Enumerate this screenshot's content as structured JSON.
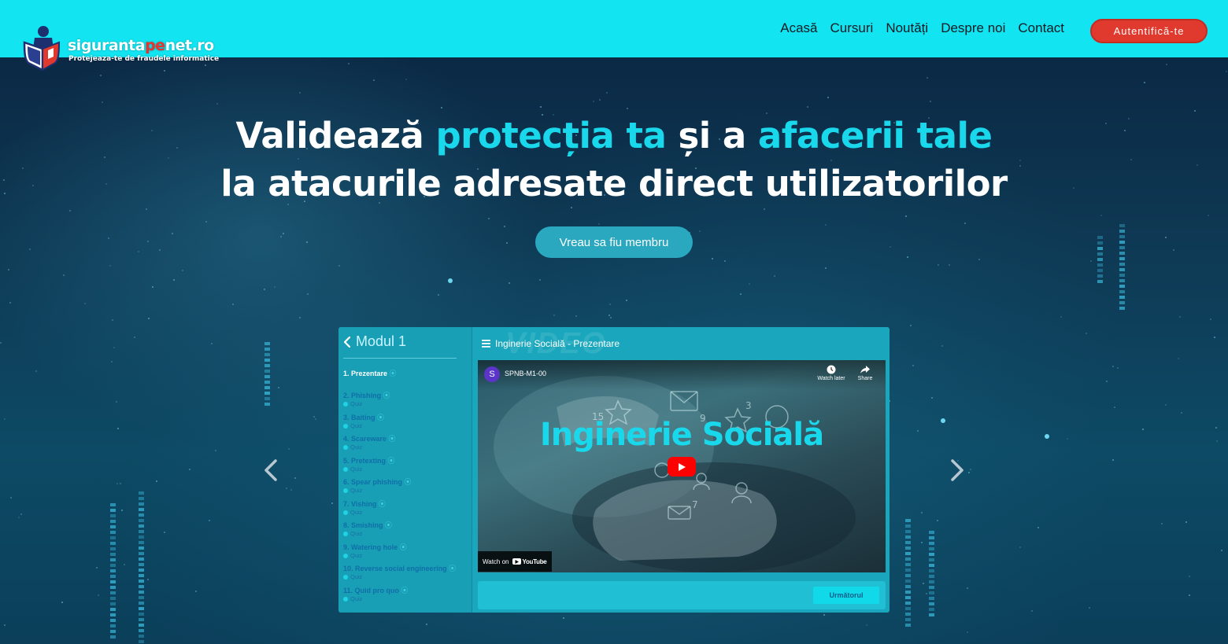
{
  "brand": {
    "name_part1": "siguranta",
    "name_accent": "pe",
    "name_part2": "net.ro",
    "tagline": "Protejeaza-te de fraudele informatice"
  },
  "nav": {
    "items": [
      "Acasă",
      "Cursuri",
      "Noutăți",
      "Despre noi",
      "Contact"
    ],
    "login_label": "Autentifică-te"
  },
  "hero": {
    "line1_a": "Validează ",
    "line1_b": "protecția ta",
    "line1_c": " și a ",
    "line1_d": "afacerii tale",
    "line2": "la atacurile adresate direct utilizatorilor",
    "cta_label": "Vreau sa fiu membru"
  },
  "slide": {
    "module_title": "Modul 1",
    "watermark": "VIDEO",
    "content_title": "Inginerie Socială - Prezentare",
    "lessons": [
      {
        "title": "1. Prezentare",
        "quiz": ""
      },
      {
        "title": "2. Phishing",
        "quiz": "Quiz"
      },
      {
        "title": "3. Baiting",
        "quiz": "Quiz"
      },
      {
        "title": "4. Scareware",
        "quiz": "Quiz"
      },
      {
        "title": "5. Pretexting",
        "quiz": "Quiz"
      },
      {
        "title": "6. Spear phishing",
        "quiz": "Quiz"
      },
      {
        "title": "7. Vishing",
        "quiz": "Quiz"
      },
      {
        "title": "8. Smishing",
        "quiz": "Quiz"
      },
      {
        "title": "9. Watering hole",
        "quiz": "Quiz"
      },
      {
        "title": "10. Reverse social engineering",
        "quiz": "Quiz"
      },
      {
        "title": "11. Quid pro quo",
        "quiz": "Quiz"
      }
    ],
    "video": {
      "channel_initial": "S",
      "video_id": "SPNB-M1-00",
      "watch_later": "Watch later",
      "share": "Share",
      "title": "Inginerie Socială",
      "watch_on": "Watch on",
      "youtube": "YouTube"
    },
    "next_label": "Următorul"
  },
  "colors": {
    "header_bg": "#12e4f1",
    "accent_cyan": "#19d8ec",
    "login_red": "#e0392d",
    "cta_teal": "#2aa8c0"
  },
  "icons": [
    "logo-shield-icon",
    "chevron-left-icon",
    "chevron-right-icon",
    "menu-icon",
    "clock-icon",
    "share-icon",
    "youtube-play-icon"
  ]
}
